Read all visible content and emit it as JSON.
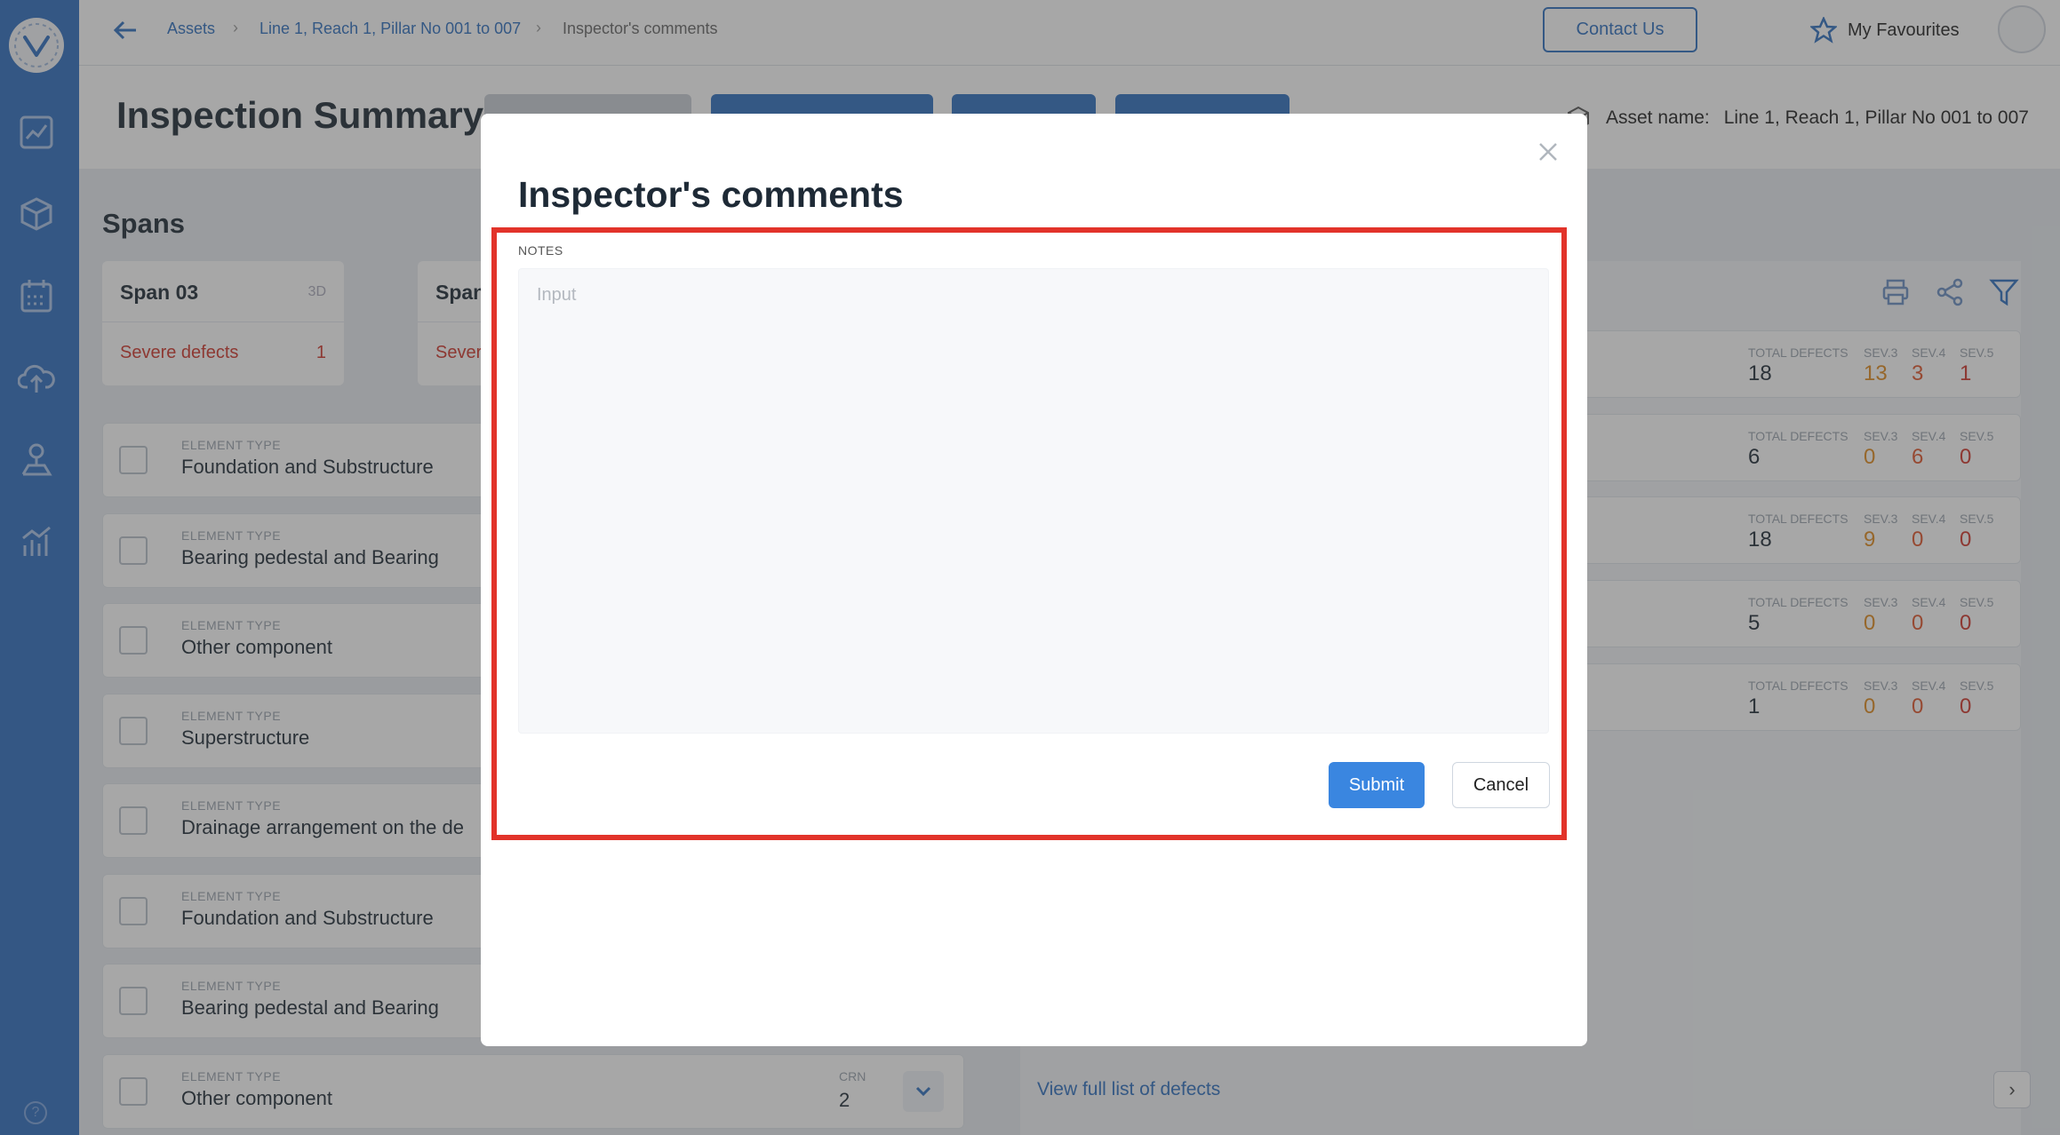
{
  "colors": {
    "sidebar": "#2e6ec0",
    "accent": "#2f6fbf",
    "submit": "#3a86e0",
    "highlight": "#e2332a",
    "severe": "#d0352a",
    "sev3": "#e08a1e",
    "sev4": "#e0552a"
  },
  "topbar": {
    "breadcrumb": [
      "Assets",
      "Line 1, Reach 1, Pillar No 001 to 007",
      "Inspector's comments"
    ],
    "contact_label": "Contact Us",
    "favourites_label": "My Favourites"
  },
  "header": {
    "title": "Inspection Summary",
    "asset_label": "Asset name:",
    "asset_value": "Line 1, Reach 1, Pillar No 001 to 007"
  },
  "spans": {
    "title": "Spans",
    "cards": [
      {
        "name": "Span 03",
        "tag": "3D",
        "severe_label": "Severe defects",
        "severe_count": "1"
      },
      {
        "name": "Span",
        "tag": "",
        "severe_label": "Sever",
        "severe_count": ""
      }
    ]
  },
  "elements": {
    "label": "ELEMENT TYPE",
    "crn_label": "CRN",
    "rows": [
      {
        "value": "Foundation and Substructure"
      },
      {
        "value": "Bearing pedestal and Bearing"
      },
      {
        "value": "Other component"
      },
      {
        "value": "Superstructure"
      },
      {
        "value": "Drainage arrangement on the de"
      },
      {
        "value": "Foundation and Substructure"
      },
      {
        "value": "Bearing pedestal and Bearing"
      },
      {
        "value": "Other component",
        "crn": "2"
      }
    ]
  },
  "defects": {
    "total_label": "TOTAL DEFECTS",
    "sev3_label": "SEV.3",
    "sev4_label": "SEV.4",
    "sev5_label": "SEV.5",
    "rows": [
      {
        "total": "18",
        "s3": "13",
        "s4": "3",
        "s5": "1"
      },
      {
        "total": "6",
        "s3": "0",
        "s4": "6",
        "s5": "0"
      },
      {
        "total": "18",
        "s3": "9",
        "s4": "0",
        "s5": "0"
      },
      {
        "total": "5",
        "s3": "0",
        "s4": "0",
        "s5": "0"
      },
      {
        "total": "1",
        "s3": "0",
        "s4": "0",
        "s5": "0"
      }
    ],
    "view_full_label": "View full list of defects"
  },
  "modal": {
    "title": "Inspector's comments",
    "notes_label": "NOTES",
    "notes_placeholder": "Input",
    "notes_value": "",
    "submit_label": "Submit",
    "cancel_label": "Cancel"
  }
}
